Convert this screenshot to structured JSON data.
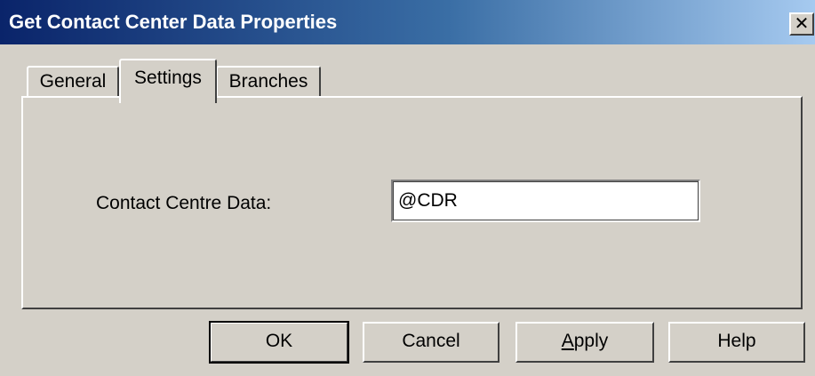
{
  "window": {
    "title": "Get Contact Center Data Properties",
    "close_glyph": "✕"
  },
  "tabs": [
    {
      "label": "General",
      "active": false
    },
    {
      "label": "Settings",
      "active": true
    },
    {
      "label": "Branches",
      "active": false
    }
  ],
  "settings": {
    "field_label": "Contact Centre Data:",
    "field_value": "@CDR"
  },
  "buttons": {
    "ok": "OK",
    "cancel": "Cancel",
    "apply_accel": "A",
    "apply_rest": "pply",
    "help": "Help"
  },
  "colors": {
    "title_bar_start": "#0a246a",
    "title_bar_end": "#a6caf0",
    "dialog_face": "#d4d0c8"
  }
}
